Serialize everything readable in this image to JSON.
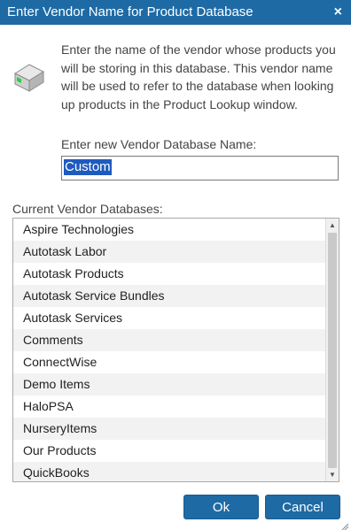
{
  "dialog": {
    "title": "Enter Vendor Name for Product Database",
    "close_glyph": "×",
    "icon": "database-drive-icon",
    "description": "Enter the name of the vendor whose products you will be storing in this database. This vendor name will be used to refer to the database when looking up products in the Product Lookup window.",
    "name_label": "Enter new Vendor Database Name:",
    "name_value": "Custom",
    "list_label": "Current Vendor Databases:",
    "vendors": [
      "Aspire Technologies",
      "Autotask Labor",
      "Autotask Products",
      "Autotask Service Bundles",
      "Autotask Services",
      "Comments",
      "ConnectWise",
      "Demo Items",
      "HaloPSA",
      "NurseryItems",
      "Our Products",
      "QuickBooks"
    ],
    "ok_label": "Ok",
    "cancel_label": "Cancel"
  },
  "colors": {
    "titlebar": "#1e6aa5",
    "button": "#1e6aa5",
    "selection": "#1e5bbf",
    "row_alt": "#f2f2f2"
  }
}
